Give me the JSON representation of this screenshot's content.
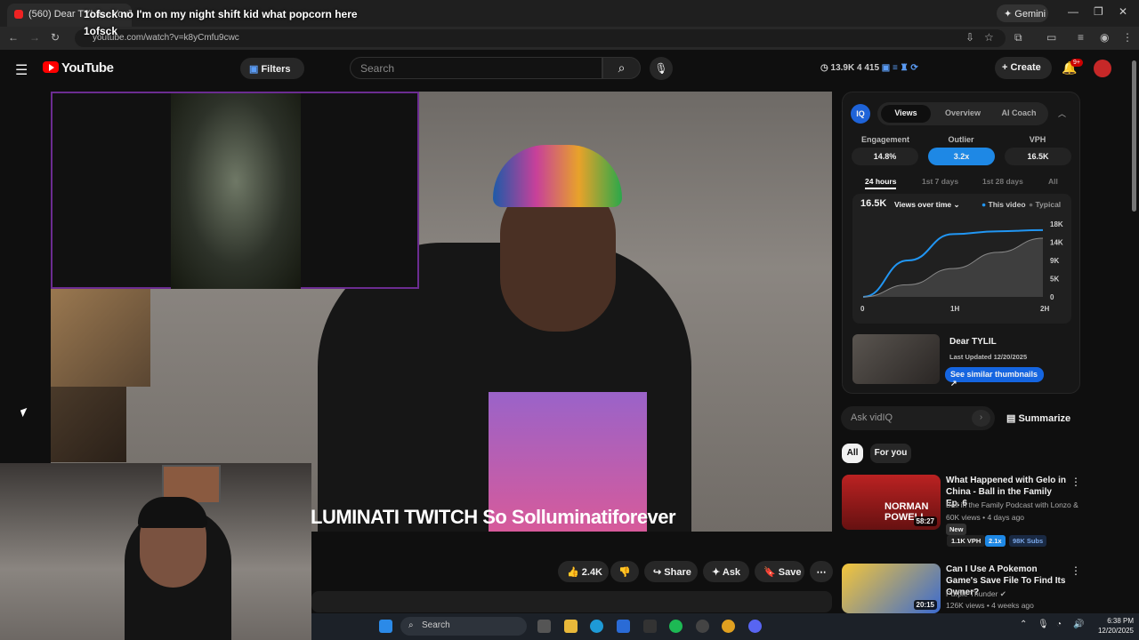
{
  "browser": {
    "tab_title": "(560) Dear TYLIL - YouTube",
    "url": "youtube.com/watch?v=k8yCmfu9cwc",
    "gemini_label": "Gemini"
  },
  "stream_overlay": {
    "chat_line": "1ofsck  no I'm on my night shift kid what popcorn here",
    "chat_user": "1ofsck",
    "ticker": "LUMINATI  TWITCH So   Solluminatiforever"
  },
  "yt_header": {
    "logo_text": "YouTube",
    "filters_label": "Filters",
    "search_placeholder": "Search",
    "stats": "13.9K   4   415",
    "create_label": "Create",
    "notif_badge": "9+"
  },
  "actions": {
    "like_count": "2.4K",
    "share": "Share",
    "ask": "Ask",
    "save": "Save"
  },
  "vidiq": {
    "logo": "IQ",
    "tabs": [
      "Views",
      "Overview",
      "AI Coach"
    ],
    "active_tab": "Views",
    "metrics": [
      {
        "label": "Engagement",
        "value": "14.8%"
      },
      {
        "label": "Outlier",
        "value": "3.2x"
      },
      {
        "label": "VPH",
        "value": "16.5K"
      }
    ],
    "ranges": [
      "24 hours",
      "1st 7 days",
      "1st 28 days",
      "All"
    ],
    "active_range": "24 hours",
    "views_total": "16.5K",
    "views_dropdown": "Views over time",
    "legend_this": "This video",
    "legend_typical": "Typical",
    "video_title": "Dear TYLIL",
    "last_updated": "Last Updated 12/20/2025",
    "similar_btn": "See similar thumbnails",
    "ask_placeholder": "Ask vidIQ",
    "summarize": "Summarize",
    "accent": "#1e88e5"
  },
  "chart_data": {
    "type": "line",
    "x": [
      "0",
      "1H",
      "2H"
    ],
    "yticks": [
      "0",
      "5K",
      "9K",
      "14K",
      "18K"
    ],
    "ylim": [
      0,
      18000
    ],
    "series": [
      {
        "name": "This video",
        "values": [
          0,
          9000,
          15500,
          16200,
          16500
        ]
      },
      {
        "name": "Typical",
        "values": [
          0,
          3000,
          7000,
          11000,
          14500
        ]
      }
    ]
  },
  "chips": [
    "All",
    "For you"
  ],
  "related": [
    {
      "title": "What Happened with Gelo in China - Ball in the Family Ep. 6",
      "channel": "Ball in the Family Podcast with Lonzo & ...",
      "meta": "60K views • 4 days ago",
      "badge": "New",
      "vph": "1.1K VPH",
      "outlier": "2.1x",
      "subs": "98K Subs",
      "duration": "58:27",
      "thumb_text": "NORMAN POWELL"
    },
    {
      "title": "Can I Use A Pokemon Game's Save File To Find Its Owner?",
      "channel": "Purple Thunder",
      "meta": "126K views • 4 weeks ago",
      "duration": "20:15"
    }
  ],
  "taskbar": {
    "search": "Search",
    "time": "6:38 PM",
    "date": "12/20/2025"
  }
}
